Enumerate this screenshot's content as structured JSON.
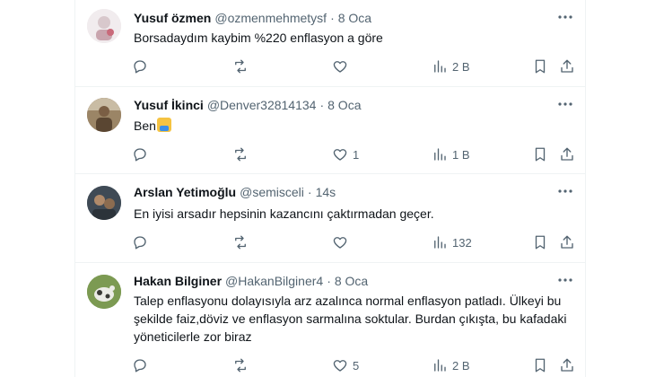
{
  "tweets": [
    {
      "name": "Yusuf özmen",
      "handle": "@ozmenmehmetysf",
      "time": "8 Oca",
      "text": "Borsadaydım kaybim %220 enflasyon a göre",
      "replies": "",
      "retweets": "",
      "likes": "",
      "views": "2 B",
      "avatar_color": "#e9dfe3"
    },
    {
      "name": "Yusuf İkinci",
      "handle": "@Denver32814134",
      "time": "8 Oca",
      "text": "Ben",
      "emoji": "person-raising-hand-emoji",
      "replies": "",
      "retweets": "",
      "likes": "1",
      "views": "1 B",
      "avatar_color": "#8a6f52"
    },
    {
      "name": "Arslan Yetimoğlu",
      "handle": "@semisceli",
      "time": "14s",
      "text": "En iyisi arsadır hepsinin kazancını çaktırmadan geçer.",
      "replies": "",
      "retweets": "",
      "likes": "",
      "views": "132",
      "avatar_color": "#4a5a6a"
    },
    {
      "name": "Hakan Bilginer",
      "handle": "@HakanBilginer4",
      "time": "8 Oca",
      "text": "Talep enflasyonu dolayısıyla arz azalınca normal enflasyon patladı. Ülkeyi bu şekilde faiz,döviz ve enflasyon sarmalına soktular. Burdan çıkışta, bu kafadaki yöneticilerle zor biraz",
      "replies": "",
      "retweets": "",
      "likes": "5",
      "views": "2 B",
      "avatar_color": "#6f8f4a"
    }
  ],
  "colors": {
    "text": "#0f1419",
    "secondary": "#536471",
    "divider": "#eff3f4"
  },
  "icons": [
    "reply-icon",
    "retweet-icon",
    "like-icon",
    "views-icon",
    "bookmark-icon",
    "share-icon",
    "more-icon"
  ]
}
